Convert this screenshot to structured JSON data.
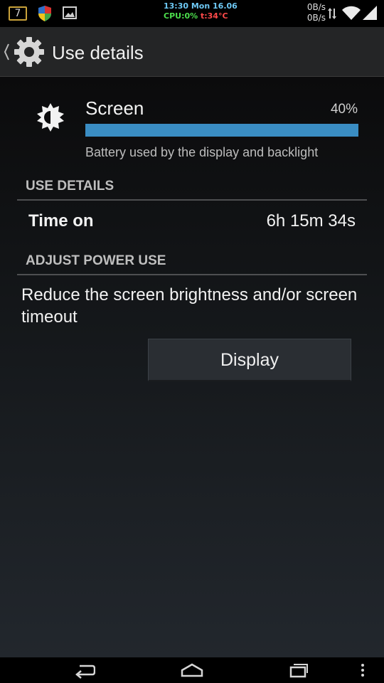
{
  "status_bar": {
    "calendar_day": "7",
    "time_line": "13:30 Mon 16.06",
    "cpu_label": "CPU:0%",
    "temp_label": "t:34°C",
    "net_up": "0B/s",
    "net_down": "0B/s",
    "icons": [
      "calendar-icon",
      "shield-icon",
      "photo-icon",
      "data-arrows-icon",
      "wifi-icon",
      "signal-icon"
    ],
    "colors": {
      "time": "#6ec9f5",
      "cpu": "#4ddf4d",
      "temp": "#ff4a4a"
    }
  },
  "action_bar": {
    "title": "Use details",
    "icon": "settings-gear-icon"
  },
  "app": {
    "name": "Screen",
    "percent": "40%",
    "usage_fraction": 1.0,
    "description": "Battery used by the display and backlight",
    "icon": "brightness-icon",
    "bar_color": "#3a8dc3"
  },
  "use_details": {
    "header": "USE DETAILS",
    "rows": [
      {
        "label": "Time on",
        "value": "6h 15m 34s"
      }
    ]
  },
  "adjust_power": {
    "header": "ADJUST POWER USE",
    "text": "Reduce the screen brightness and/or screen timeout",
    "button_label": "Display"
  },
  "nav_bar": {
    "icons": [
      "back-icon",
      "home-icon",
      "recent-apps-icon",
      "overflow-menu-icon"
    ]
  }
}
